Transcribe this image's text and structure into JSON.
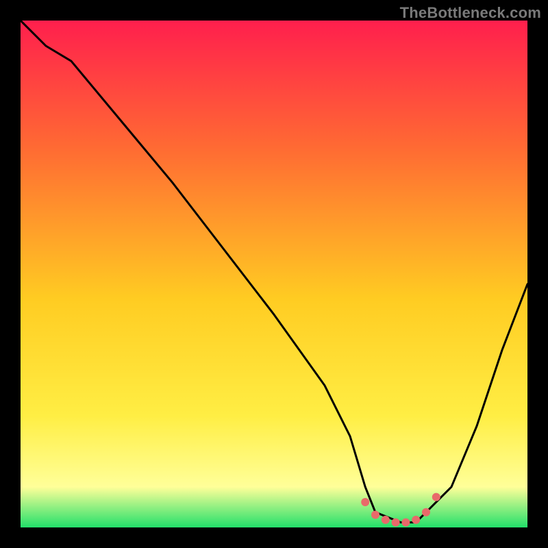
{
  "watermark": "TheBottleneck.com",
  "colors": {
    "background": "#000000",
    "gradient_top": "#ff1f4d",
    "gradient_mid_top": "#ff6a33",
    "gradient_mid": "#ffcc22",
    "gradient_mid_low": "#ffee44",
    "gradient_low": "#ffff99",
    "gradient_bottom": "#22e06a",
    "curve": "#000000",
    "marker": "#e86a6a"
  },
  "chart_data": {
    "type": "line",
    "title": "",
    "xlabel": "",
    "ylabel": "",
    "xlim": [
      0,
      100
    ],
    "ylim": [
      0,
      100
    ],
    "series": [
      {
        "name": "bottleneck-curve",
        "x": [
          0,
          5,
          10,
          20,
          30,
          40,
          50,
          60,
          65,
          68,
          70,
          75,
          78,
          80,
          85,
          90,
          95,
          100
        ],
        "y": [
          100,
          95,
          92,
          80,
          68,
          55,
          42,
          28,
          18,
          8,
          3,
          1,
          1,
          3,
          8,
          20,
          35,
          48
        ]
      }
    ],
    "markers": {
      "name": "highlight-range",
      "x": [
        68,
        70,
        72,
        74,
        76,
        78,
        80,
        82
      ],
      "y": [
        5,
        2.5,
        1.5,
        1,
        1,
        1.5,
        3,
        6
      ]
    }
  }
}
